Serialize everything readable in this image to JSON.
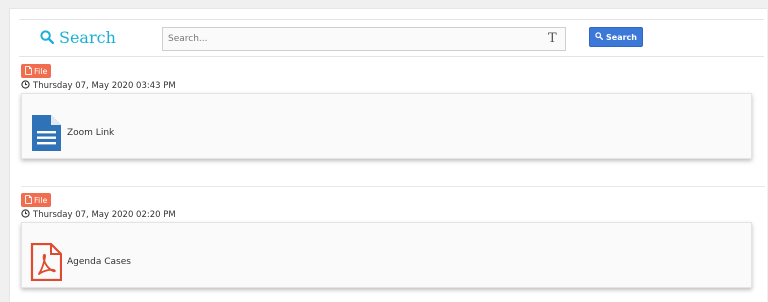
{
  "header": {
    "title": "Search",
    "search_placeholder": "Search...",
    "search_button_label": "Search"
  },
  "entries": [
    {
      "badge": "File",
      "timestamp": "Thursday 07, May 2020 03:43 PM",
      "name": "Zoom Link",
      "icon": "document-icon",
      "icon_color": "#2f72b8"
    },
    {
      "badge": "File",
      "timestamp": "Thursday 07, May 2020 02:20 PM",
      "name": "Agenda Cases",
      "icon": "pdf-icon",
      "icon_color": "#e04a2f"
    }
  ],
  "colors": {
    "accent": "#1ab0d6",
    "button": "#3b78d8",
    "badge": "#f06d4f"
  }
}
